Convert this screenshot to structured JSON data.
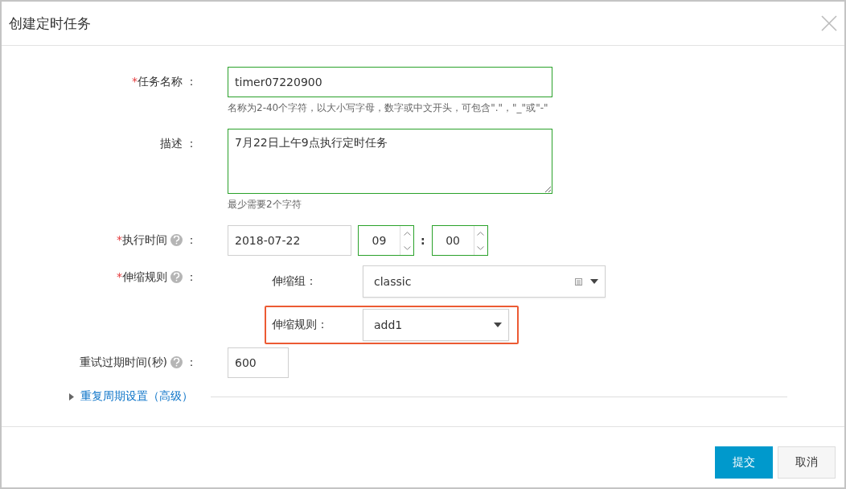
{
  "dialog": {
    "title": "创建定时任务"
  },
  "required_mark": "*",
  "fields": [
    {
      "kind": "text",
      "label": "任务名称",
      "colon": "：",
      "required": true,
      "help": false,
      "value": "timer07220900",
      "valid": true,
      "hint": "名称为2-40个字符，以大小写字母，数字或中文开头，可包含\".\"，\"_\"或\"-\""
    },
    {
      "kind": "textarea",
      "label": "描述",
      "colon": "：",
      "required": false,
      "help": false,
      "value": "7月22日上午9点执行定时任务",
      "valid": true,
      "hint": "最少需要2个字符"
    },
    {
      "kind": "datetime",
      "label": "执行时间",
      "colon": "：",
      "required": true,
      "help": true,
      "date": {
        "value": "2018-07-22",
        "valid": false
      },
      "hour": {
        "value": "09",
        "valid": true
      },
      "separator": ":",
      "minute": {
        "value": "00",
        "valid": true
      }
    },
    {
      "kind": "rule",
      "label": "伸缩规则",
      "colon": "：",
      "required": true,
      "help": true,
      "subfields": [
        {
          "label": "伸缩组：",
          "value": "classic",
          "highlighted": false,
          "list_icon": true
        },
        {
          "label": "伸缩规则：",
          "value": "add1",
          "highlighted": true,
          "list_icon": false
        }
      ]
    },
    {
      "kind": "number",
      "label": "重试过期时间(秒)",
      "colon": "：",
      "required": false,
      "help": true,
      "value": "600",
      "valid": false
    }
  ],
  "advanced": {
    "label": "重复周期设置（高级）",
    "expanded": false
  },
  "buttons": [
    {
      "label": "提交",
      "primary": true
    },
    {
      "label": "取消",
      "primary": false
    }
  ]
}
